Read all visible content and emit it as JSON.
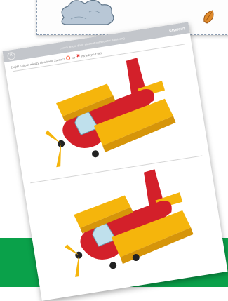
{
  "sheet": {
    "close_icon": "close-icon",
    "header_title": "Lorem ipsum dolor sit amet consectetur adipiscing",
    "save_label": "SAVE/OUT",
    "instruction_prefix": "Znajdź 5 różnic między obrazkami. Zaznacz",
    "instruction_mid": "lub",
    "instruction_suffix": "na jednym z nich",
    "circle_icon": "circle-icon",
    "x_icon": "x-icon",
    "x_glyph": "✖"
  },
  "colors": {
    "topbar": "#c3c6cb",
    "fuselage": "#d3202a",
    "wings": "#f5b50c",
    "green_band": "#0aa14a"
  }
}
